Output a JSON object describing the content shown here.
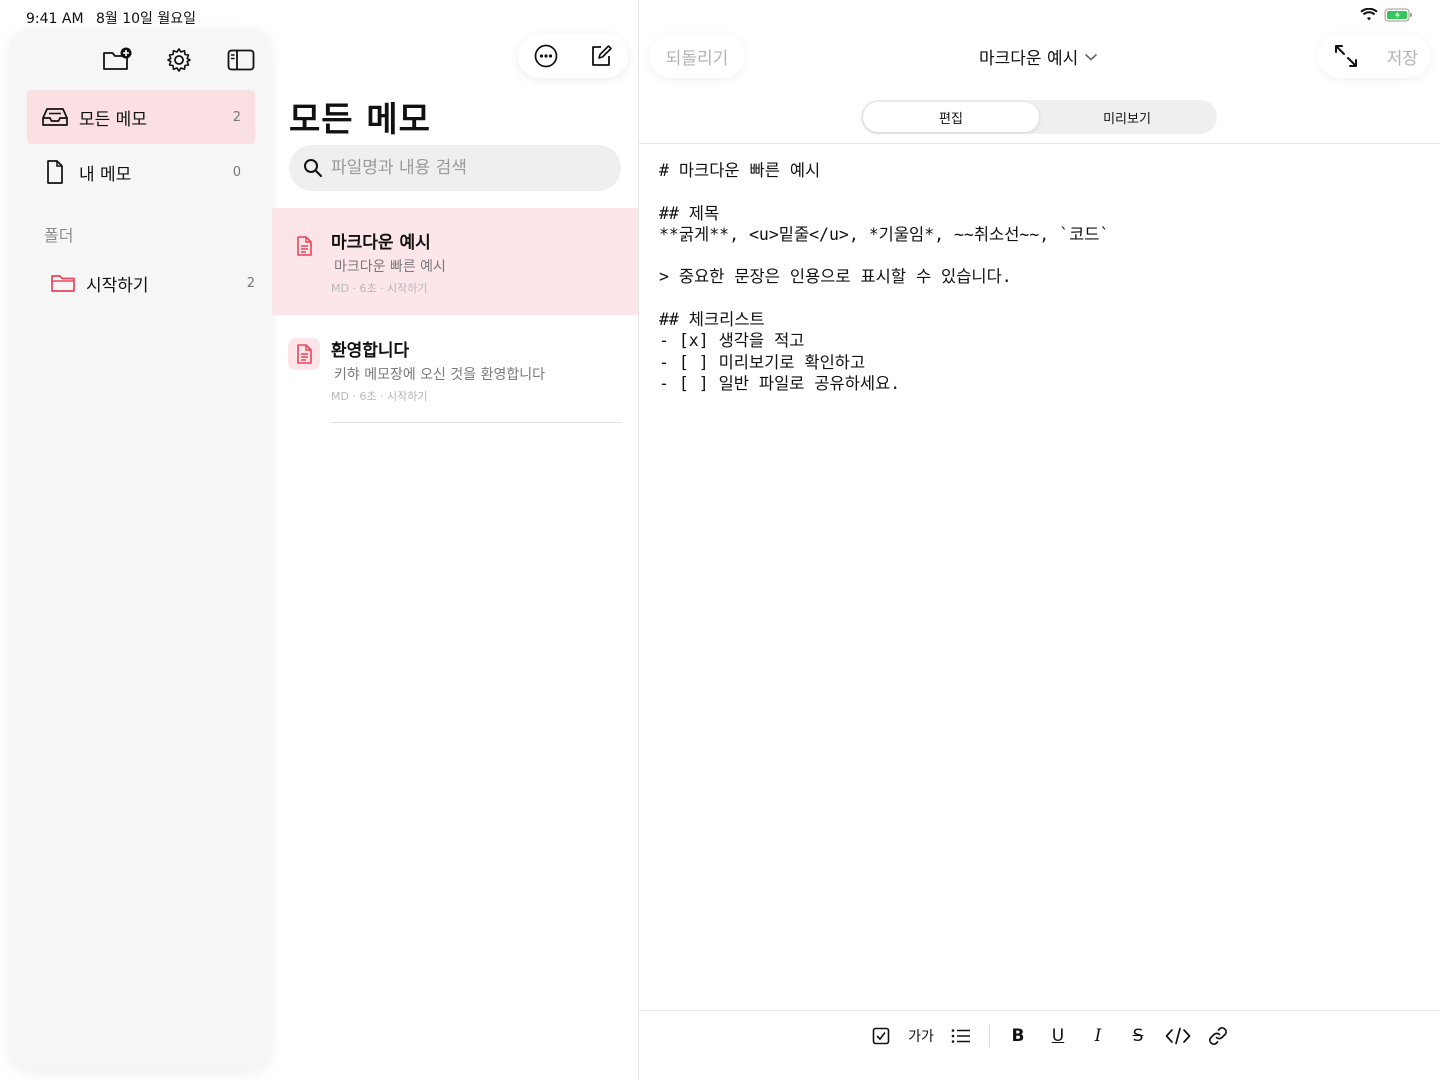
{
  "status": {
    "time": "9:41 AM",
    "date": "8월 10일 월요일"
  },
  "sidebar": {
    "items": [
      {
        "label": "모든 메모",
        "count": "2",
        "icon": "tray-icon"
      },
      {
        "label": "내 메모",
        "count": "0",
        "icon": "document-icon"
      }
    ],
    "section_label": "폴더",
    "folders": [
      {
        "label": "시작하기",
        "count": "2",
        "icon": "folder-icon"
      }
    ]
  },
  "list": {
    "title": "모든 메모",
    "search_placeholder": "파일명과 내용 검색",
    "notes": [
      {
        "title": "마크다운 예시",
        "preview": "마크다운 빠른 예시",
        "meta": "MD · 6초 · 시작하기"
      },
      {
        "title": "환영합니다",
        "preview": "키햐 메모장에 오신 것을 환영합니다",
        "meta": "MD · 6초 · 시작하기"
      }
    ]
  },
  "editor": {
    "undo_label": "되돌리기",
    "doc_title": "마크다운 예시",
    "save_label": "저장",
    "tabs": [
      "편집",
      "미리보기"
    ],
    "content": "# 마크다운 빠른 예시\n\n## 제목\n**굵게**, <u>밑줄</u>, *기울임*, ~~취소선~~, `코드`\n\n> 중요한 문장은 인용으로 표시할 수 있습니다.\n\n## 체크리스트\n- [x] 생각을 적고\n- [ ] 미리보기로 확인하고\n- [ ] 일반 파일로 공유하세요.",
    "format_bar": {
      "text_size_label": "가가",
      "bold_label": "B",
      "underline_label": "U",
      "italic_label": "I",
      "strike_label": "S"
    }
  },
  "colors": {
    "accent": "#e8455b",
    "selected_bg": "#fde6ea",
    "sidebar_selected_bg": "#fadfe3"
  }
}
